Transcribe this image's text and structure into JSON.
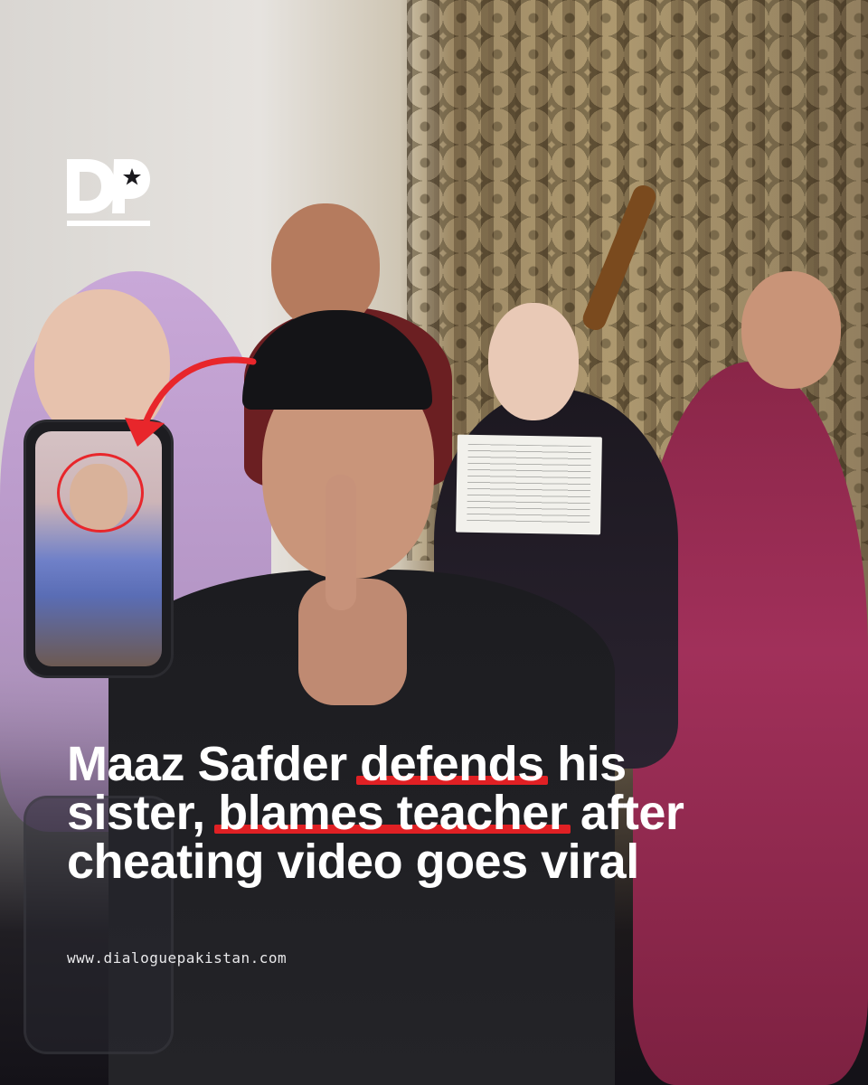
{
  "brand": {
    "logo_text": "DP",
    "accent_color": "#e02024"
  },
  "headline": {
    "line1_pre": "Maaz Safder ",
    "line1_highlight": "defends",
    "line1_post": " his",
    "line2_pre": "sister, ",
    "line2_highlight": "blames teacher",
    "line2_post": " after",
    "line3": "cheating video goes viral"
  },
  "footer": {
    "url": "www.dialoguepakistan.com"
  },
  "icons": {
    "logo": "dialogue-pakistan-logo",
    "arrow": "curved-red-arrow-icon"
  }
}
